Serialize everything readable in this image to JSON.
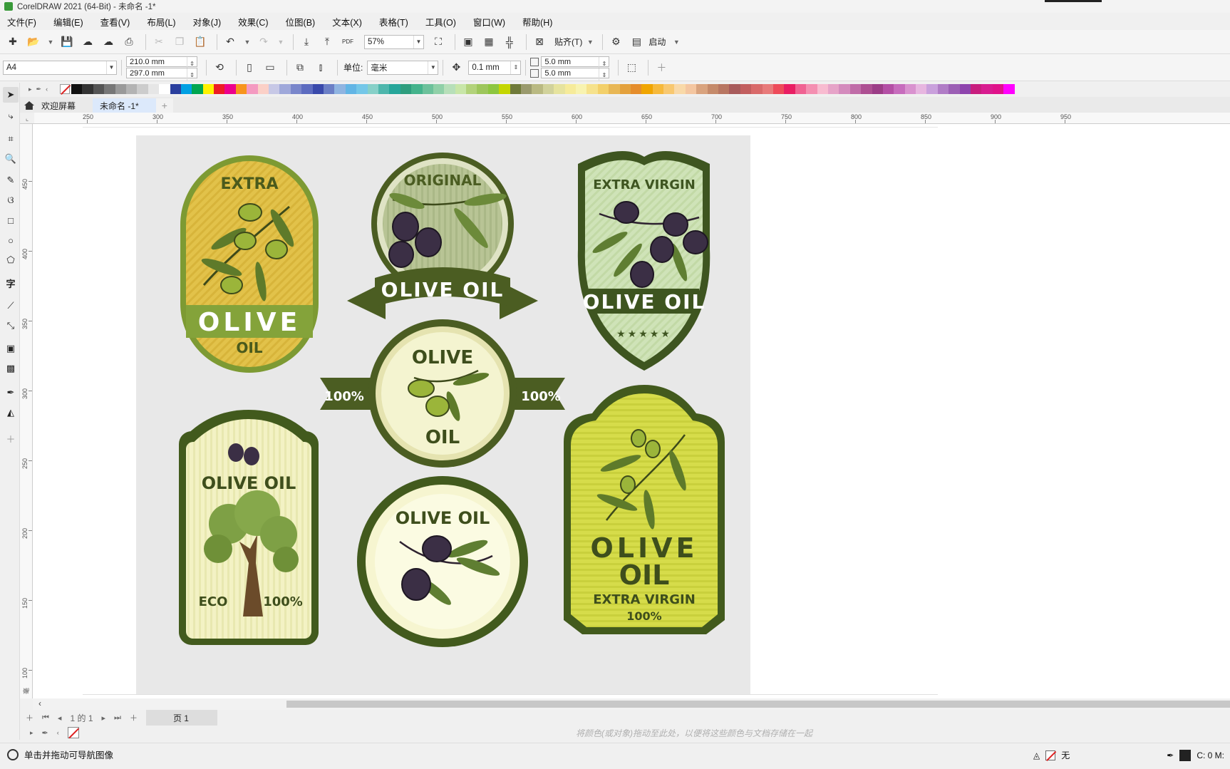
{
  "window": {
    "title": "CorelDRAW 2021 (64-Bit) - 未命名 -1*"
  },
  "menu": [
    "文件(F)",
    "编辑(E)",
    "查看(V)",
    "布局(L)",
    "对象(J)",
    "效果(C)",
    "位图(B)",
    "文本(X)",
    "表格(T)",
    "工具(O)",
    "窗口(W)",
    "帮助(H)"
  ],
  "toolbar": {
    "zoom": "57%",
    "snap_label": "贴齐(T)",
    "launch_label": "启动"
  },
  "property_bar": {
    "page_size": "A4",
    "width": "210.0 mm",
    "height": "297.0 mm",
    "units_label": "单位:",
    "units_value": "毫米",
    "nudge": "0.1 mm",
    "dup_x": "5.0 mm",
    "dup_y": "5.0 mm"
  },
  "document_tabs": [
    "欢迎屏幕",
    "未命名 -1*"
  ],
  "ruler": {
    "h_ticks": [
      "250",
      "300",
      "350",
      "400",
      "450",
      "500",
      "550",
      "600",
      "650",
      "700",
      "750",
      "800",
      "850",
      "900",
      "950"
    ],
    "v_ticks": [
      "450",
      "400",
      "350",
      "300",
      "250",
      "200",
      "150",
      "100"
    ],
    "unit": "毫米"
  },
  "artwork": {
    "labels": [
      {
        "top": "EXTRA",
        "main": "OLIVE",
        "bottom": "OIL"
      },
      {
        "top": "ORIGINAL",
        "main": "OLIVE OIL"
      },
      {
        "top": "EXTRA VIRGIN",
        "main": "OLIVE OIL",
        "stars": "★★★★★"
      },
      {
        "top": "OLIVE",
        "bottom": "OIL",
        "left": "100%",
        "right": "100%"
      },
      {
        "main": "OLIVE OIL",
        "left": "ECO",
        "right": "100%"
      },
      {
        "main": "OLIVE OIL"
      },
      {
        "main1": "OLIVE",
        "main2": "OIL",
        "sub": "EXTRA VIRGIN",
        "pct": "100%"
      }
    ]
  },
  "page_nav": {
    "current": "1",
    "of_label": "的",
    "total": "1",
    "page_tab": "页 1"
  },
  "color_hint": "将颜色(或对象)拖动至此处，以便将这些颜色与文档存储在一起",
  "status": {
    "message": "单击并拖动可导航图像",
    "fill_none": "无",
    "cmyk": "C: 0 M:"
  },
  "palette_colors": [
    "#111111",
    "#333333",
    "#555555",
    "#777777",
    "#999999",
    "#b3b3b3",
    "#cccccc",
    "#e6e6e6",
    "#ffffff",
    "#2a3f9e",
    "#00a0e3",
    "#00a651",
    "#fff200",
    "#ed1c24",
    "#ec008c",
    "#f7941d",
    "#f49ac1",
    "#fbd0c7",
    "#c7c8e6",
    "#9fa8da",
    "#7986cb",
    "#5c6bc0",
    "#3949ab",
    "#6b7fc6",
    "#8fb4e1",
    "#62b5e5",
    "#74c7e8",
    "#86d0c8",
    "#4db6ac",
    "#26a69a",
    "#2e9e7e",
    "#44b38c",
    "#6cc19b",
    "#90d0a8",
    "#b7dfb9",
    "#c8e6a8",
    "#b2d27a",
    "#9dc65b",
    "#8dc63f",
    "#c4d600",
    "#6f7a39",
    "#9a9a6d",
    "#b9b982",
    "#d1d29b",
    "#e6e39e",
    "#f6eb9a",
    "#f8f3b0",
    "#f6e28c",
    "#f3d06a",
    "#e8b755",
    "#e4a13c",
    "#e58d2b",
    "#f0a500",
    "#f6b93b",
    "#f8c870",
    "#f9d9a8",
    "#f4c6a0",
    "#d9a37e",
    "#c58a6a",
    "#b87661",
    "#a85b5b",
    "#c25e5e",
    "#d96a6a",
    "#e87a7a",
    "#ee4b5a",
    "#e91e63",
    "#f06292",
    "#f48fb1",
    "#f8bbd0",
    "#e6a3c8",
    "#d48bbd",
    "#c06ca8",
    "#ad4f92",
    "#9c3d87",
    "#b44fa5",
    "#c76cbd",
    "#d992cf",
    "#e7b6e0",
    "#c9a0dc",
    "#b07cc6",
    "#9c5fb5",
    "#8e44ad",
    "#c81d7e",
    "#d81b8f",
    "#e0118a",
    "#ff00ff"
  ]
}
